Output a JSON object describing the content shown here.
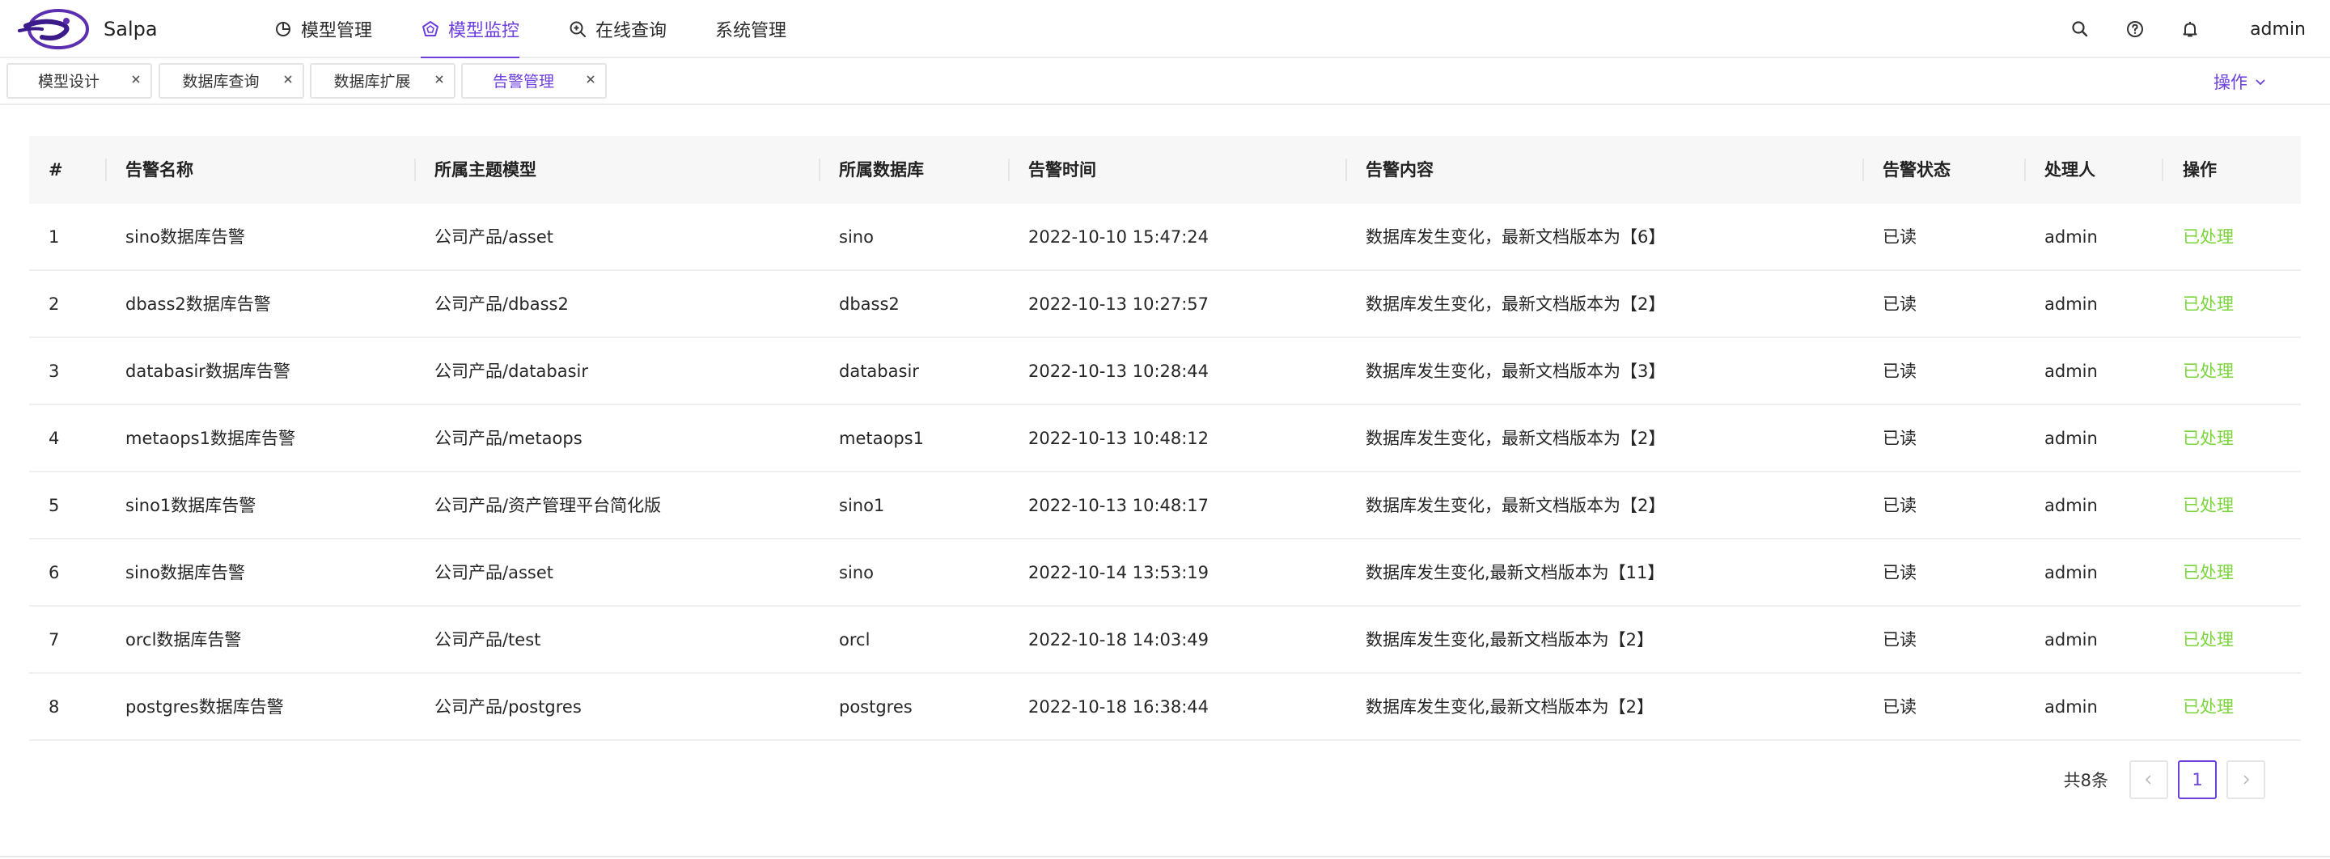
{
  "app": {
    "brand": "Salpa",
    "user": "admin"
  },
  "nav": [
    {
      "label": "模型管理",
      "icon": "pie-chart-icon",
      "active": false
    },
    {
      "label": "模型监控",
      "icon": "monitor-icon",
      "active": true
    },
    {
      "label": "在线查询",
      "icon": "search-plus-icon",
      "active": false
    },
    {
      "label": "系统管理",
      "icon": "",
      "active": false
    }
  ],
  "header_icons": [
    "search-icon",
    "help-icon",
    "bell-icon"
  ],
  "tabs": [
    {
      "label": "模型设计",
      "active": false
    },
    {
      "label": "数据库查询",
      "active": false
    },
    {
      "label": "数据库扩展",
      "active": false
    },
    {
      "label": "告警管理",
      "active": true
    }
  ],
  "tab_actions_label": "操作",
  "table": {
    "columns": [
      "#",
      "告警名称",
      "所属主题模型",
      "所属数据库",
      "告警时间",
      "告警内容",
      "告警状态",
      "处理人",
      "操作"
    ],
    "rows": [
      [
        "1",
        "sino数据库告警",
        "公司产品/asset",
        "sino",
        "2022-10-10 15:47:24",
        "数据库发生变化，最新文档版本为【6】",
        "已读",
        "admin",
        "已处理"
      ],
      [
        "2",
        "dbass2数据库告警",
        "公司产品/dbass2",
        "dbass2",
        "2022-10-13 10:27:57",
        "数据库发生变化，最新文档版本为【2】",
        "已读",
        "admin",
        "已处理"
      ],
      [
        "3",
        "databasir数据库告警",
        "公司产品/databasir",
        "databasir",
        "2022-10-13 10:28:44",
        "数据库发生变化，最新文档版本为【3】",
        "已读",
        "admin",
        "已处理"
      ],
      [
        "4",
        "metaops1数据库告警",
        "公司产品/metaops",
        "metaops1",
        "2022-10-13 10:48:12",
        "数据库发生变化，最新文档版本为【2】",
        "已读",
        "admin",
        "已处理"
      ],
      [
        "5",
        "sino1数据库告警",
        "公司产品/资产管理平台简化版",
        "sino1",
        "2022-10-13 10:48:17",
        "数据库发生变化，最新文档版本为【2】",
        "已读",
        "admin",
        "已处理"
      ],
      [
        "6",
        "sino数据库告警",
        "公司产品/asset",
        "sino",
        "2022-10-14 13:53:19",
        "数据库发生变化,最新文档版本为【11】",
        "已读",
        "admin",
        "已处理"
      ],
      [
        "7",
        "orcl数据库告警",
        "公司产品/test",
        "orcl",
        "2022-10-18 14:03:49",
        "数据库发生变化,最新文档版本为【2】",
        "已读",
        "admin",
        "已处理"
      ],
      [
        "8",
        "postgres数据库告警",
        "公司产品/postgres",
        "postgres",
        "2022-10-18 16:38:44",
        "数据库发生变化,最新文档版本为【2】",
        "已读",
        "admin",
        "已处理"
      ]
    ]
  },
  "pagination": {
    "total_label": "共8条",
    "current_page": "1"
  },
  "colors": {
    "accent": "#6d3fdc",
    "done": "#7bd53b",
    "header_bg": "#f7f7f7"
  }
}
